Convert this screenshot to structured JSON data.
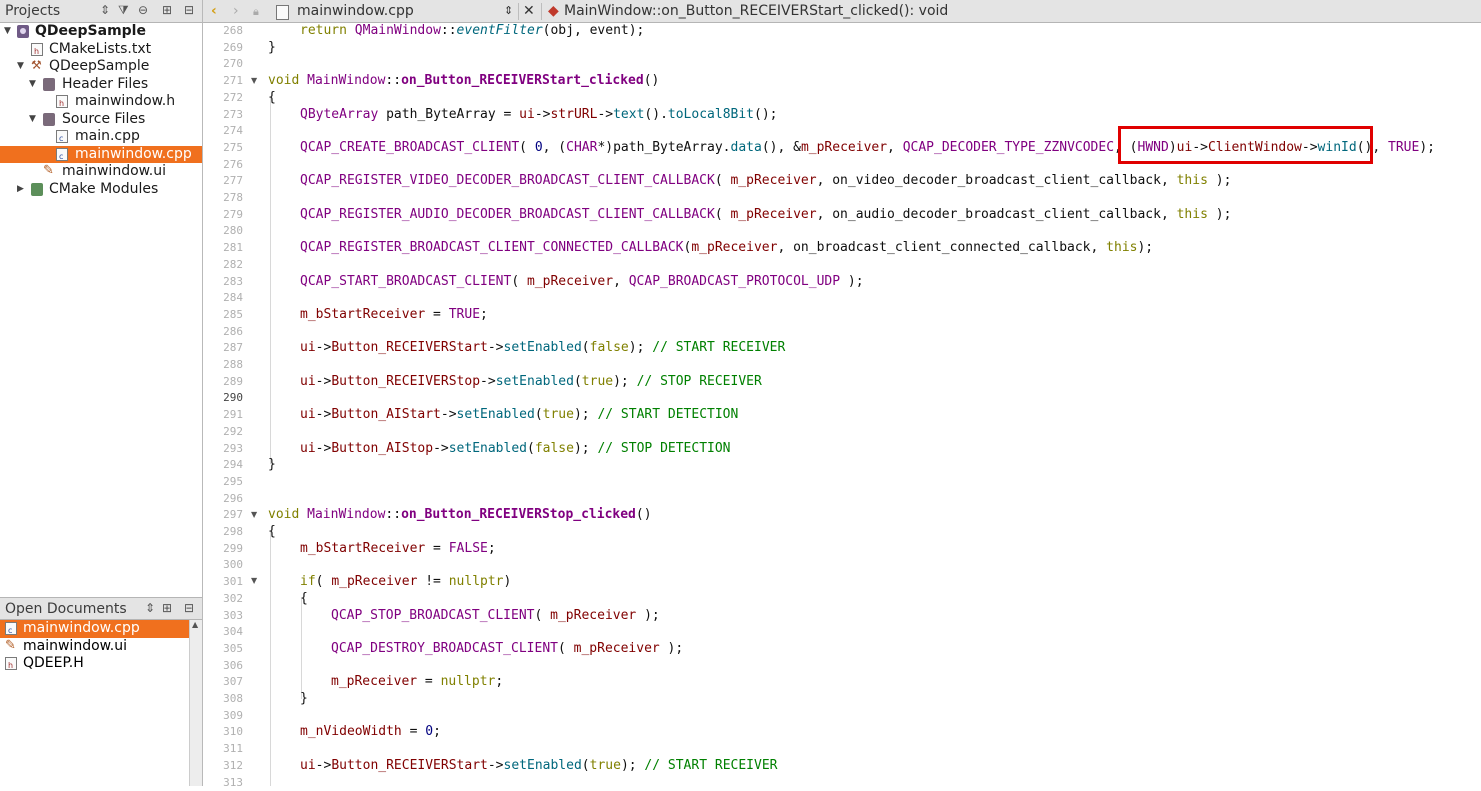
{
  "projects_panel": {
    "title": "Projects",
    "tree": [
      {
        "label": "QDeepSample",
        "icon": "project-icon",
        "bold": true,
        "expanded": true
      },
      {
        "label": "CMakeLists.txt",
        "icon": "cmake-file-icon"
      },
      {
        "label": "QDeepSample",
        "icon": "build-target-icon",
        "expanded": true
      },
      {
        "label": "Header Files",
        "icon": "folder-icon",
        "expanded": true
      },
      {
        "label": "mainwindow.h",
        "icon": "header-file-icon"
      },
      {
        "label": "Source Files",
        "icon": "folder-icon",
        "expanded": true
      },
      {
        "label": "main.cpp",
        "icon": "cpp-file-icon"
      },
      {
        "label": "mainwindow.cpp",
        "icon": "cpp-file-icon",
        "selected": true
      },
      {
        "label": "mainwindow.ui",
        "icon": "ui-file-icon"
      },
      {
        "label": "CMake Modules",
        "icon": "cmake-folder-icon",
        "expanded": false
      }
    ]
  },
  "open_documents": {
    "title": "Open Documents",
    "items": [
      {
        "label": "mainwindow.cpp",
        "selected": true
      },
      {
        "label": "mainwindow.ui"
      },
      {
        "label": "QDEEP.H"
      }
    ]
  },
  "editor": {
    "file_name": "mainwindow.cpp",
    "function_name": "MainWindow::on_Button_RECEIVERStart_clicked(): void",
    "current_line": "290",
    "highlight_color": "#e00000",
    "line_numbers": [
      "268",
      "269",
      "270",
      "271",
      "272",
      "273",
      "274",
      "275",
      "276",
      "277",
      "278",
      "279",
      "280",
      "281",
      "282",
      "283",
      "284",
      "285",
      "286",
      "287",
      "288",
      "289",
      "290",
      "291",
      "292",
      "293",
      "294",
      "295",
      "296",
      "297",
      "298",
      "299",
      "300",
      "301",
      "302",
      "303",
      "304",
      "305",
      "306",
      "307",
      "308",
      "309",
      "310",
      "311",
      "312",
      "313"
    ]
  },
  "code": {
    "l268": {
      "a": "return ",
      "b": "QMainWindow",
      "c": "::",
      "d": "eventFilter",
      "e": "(obj, event);"
    },
    "l269": "}",
    "l271": {
      "a": "void ",
      "b": "MainWindow",
      "c": "::",
      "d": "on_Button_RECEIVERStart_clicked",
      "e": "()"
    },
    "l272": "{",
    "l273": {
      "a": "QByteArray",
      "b": " path_ByteArray = ",
      "c": "ui",
      "d": "->",
      "e": "strURL",
      "f": "->",
      "g": "text",
      "h": "().",
      "i": "toLocal8Bit",
      "j": "();"
    },
    "l275": {
      "a": "QCAP_CREATE_BROADCAST_CLIENT",
      "b": "( ",
      "c": "0",
      "d": ", (",
      "e": "CHAR",
      "f": "*)path_ByteArray.",
      "g": "data",
      "h": "(), &",
      "i": "m_pReceiver",
      "j": ", ",
      "k": "QCAP_DECODER_TYPE_ZZNVCODEC",
      "l": ", (",
      "m": "HWND",
      "n": ")",
      "o": "ui",
      "p": "->",
      "q": "ClientWindow",
      "r": "->",
      "s": "winId",
      "t": "(), ",
      "u": "TRUE",
      "v": ");"
    },
    "l277": {
      "a": "QCAP_REGISTER_VIDEO_DECODER_BROADCAST_CLIENT_CALLBACK",
      "b": "( ",
      "c": "m_pReceiver",
      "d": ", on_video_decoder_broadcast_client_callback, ",
      "e": "this",
      "f": " );"
    },
    "l279": {
      "a": "QCAP_REGISTER_AUDIO_DECODER_BROADCAST_CLIENT_CALLBACK",
      "b": "( ",
      "c": "m_pReceiver",
      "d": ", on_audio_decoder_broadcast_client_callback, ",
      "e": "this",
      "f": " );"
    },
    "l281": {
      "a": "QCAP_REGISTER_BROADCAST_CLIENT_CONNECTED_CALLBACK",
      "b": "(",
      "c": "m_pReceiver",
      "d": ", on_broadcast_client_connected_callback, ",
      "e": "this",
      "f": ");"
    },
    "l283": {
      "a": "QCAP_START_BROADCAST_CLIENT",
      "b": "( ",
      "c": "m_pReceiver",
      "d": ", ",
      "e": "QCAP_BROADCAST_PROTOCOL_UDP",
      "f": " );"
    },
    "l285": {
      "a": "m_bStartReceiver",
      "b": " = ",
      "c": "TRUE",
      "d": ";"
    },
    "l287": {
      "a": "ui",
      "b": "->",
      "c": "Button_RECEIVERStart",
      "d": "->",
      "e": "setEnabled",
      "f": "(",
      "g": "false",
      "h": "); ",
      "i": "// START RECEIVER"
    },
    "l289": {
      "a": "ui",
      "b": "->",
      "c": "Button_RECEIVERStop",
      "d": "->",
      "e": "setEnabled",
      "f": "(",
      "g": "true",
      "h": "); ",
      "i": "// STOP RECEIVER"
    },
    "l291": {
      "a": "ui",
      "b": "->",
      "c": "Button_AIStart",
      "d": "->",
      "e": "setEnabled",
      "f": "(",
      "g": "true",
      "h": "); ",
      "i": "// START DETECTION"
    },
    "l293": {
      "a": "ui",
      "b": "->",
      "c": "Button_AIStop",
      "d": "->",
      "e": "setEnabled",
      "f": "(",
      "g": "false",
      "h": "); ",
      "i": "// STOP DETECTION"
    },
    "l294": "}",
    "l297": {
      "a": "void ",
      "b": "MainWindow",
      "c": "::",
      "d": "on_Button_RECEIVERStop_clicked",
      "e": "()"
    },
    "l298": "{",
    "l299": {
      "a": "m_bStartReceiver",
      "b": " = ",
      "c": "FALSE",
      "d": ";"
    },
    "l301": {
      "a": "if",
      "b": "( ",
      "c": "m_pReceiver",
      "d": " != ",
      "e": "nullptr",
      "f": ")"
    },
    "l302": "{",
    "l303": {
      "a": "QCAP_STOP_BROADCAST_CLIENT",
      "b": "( ",
      "c": "m_pReceiver",
      "d": " );"
    },
    "l305": {
      "a": "QCAP_DESTROY_BROADCAST_CLIENT",
      "b": "( ",
      "c": "m_pReceiver",
      "d": " );"
    },
    "l307": {
      "a": "m_pReceiver",
      "b": " = ",
      "c": "nullptr",
      "d": ";"
    },
    "l308": "}",
    "l310": {
      "a": "m_nVideoWidth",
      "b": " = ",
      "c": "0",
      "d": ";"
    },
    "l312": {
      "a": "ui",
      "b": "->",
      "c": "Button_RECEIVERStart",
      "d": "->",
      "e": "setEnabled",
      "f": "(",
      "g": "true",
      "h": "); ",
      "i": "// START RECEIVER"
    }
  }
}
